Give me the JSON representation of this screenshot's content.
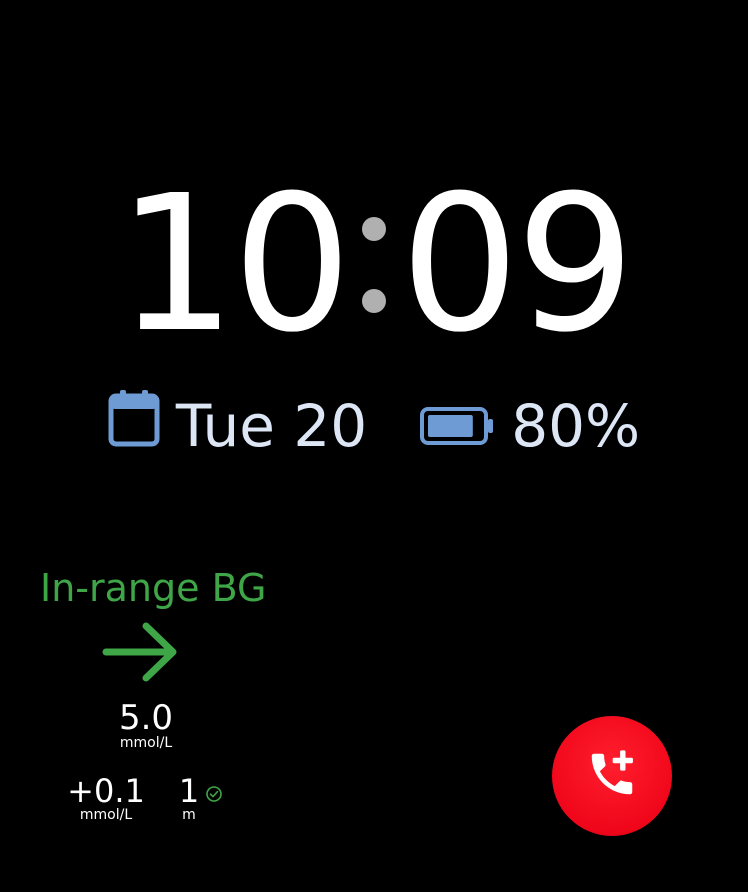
{
  "clock": {
    "hours": "10",
    "minutes": "09"
  },
  "date": {
    "label": "Tue 20",
    "icon": "calendar-icon"
  },
  "battery": {
    "label": "80%",
    "level": 0.8,
    "icon": "battery-icon"
  },
  "glucose": {
    "status": "In-range BG",
    "trend_icon": "arrow-right-icon",
    "value": "5.0",
    "unit": "mmol/L",
    "delta": "+0.1",
    "delta_unit": "mmol/L",
    "age": "1",
    "age_unit": "m",
    "age_status_icon": "check-circle-icon"
  },
  "emergency": {
    "icon": "phone-add-icon"
  },
  "colors": {
    "background": "#000000",
    "clock_text": "#ffffff",
    "colon_dots": "#b0b0b0",
    "info_text": "#dce6f4",
    "accent_blue": "#6e9bd4",
    "in_range_green": "#3fa648",
    "emergency_red": "#f0061a"
  }
}
